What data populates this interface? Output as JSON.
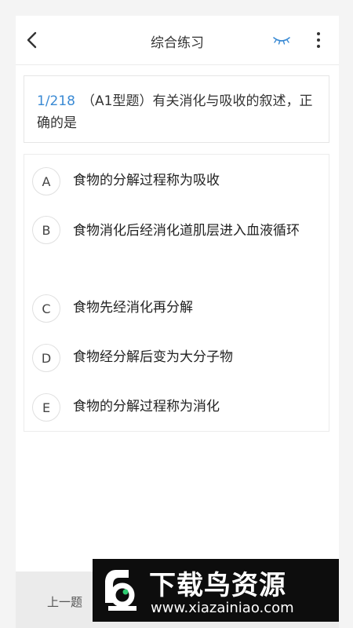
{
  "header": {
    "title": "综合练习",
    "back_icon": "chevron-left-icon",
    "eye_icon": "eye-closed-icon",
    "more_icon": "more-vertical-icon",
    "accent_color": "#3a8ad4"
  },
  "question": {
    "number": "1/218",
    "text": "（A1型题）有关消化与吸收的叙述，正确的是"
  },
  "options": [
    {
      "letter": "A",
      "text": "食物的分解过程称为吸收"
    },
    {
      "letter": "B",
      "text": "食物消化后经消化道肌层进入血液循环"
    },
    {
      "letter": "C",
      "text": "食物先经消化再分解"
    },
    {
      "letter": "D",
      "text": "食物经分解后变为大分子物"
    },
    {
      "letter": "E",
      "text": "食物的分解过程称为消化"
    }
  ],
  "footer": {
    "prev_label": "上一题"
  },
  "watermark": {
    "title": "下载鸟资源",
    "url": "www.xiazainiao.com"
  }
}
